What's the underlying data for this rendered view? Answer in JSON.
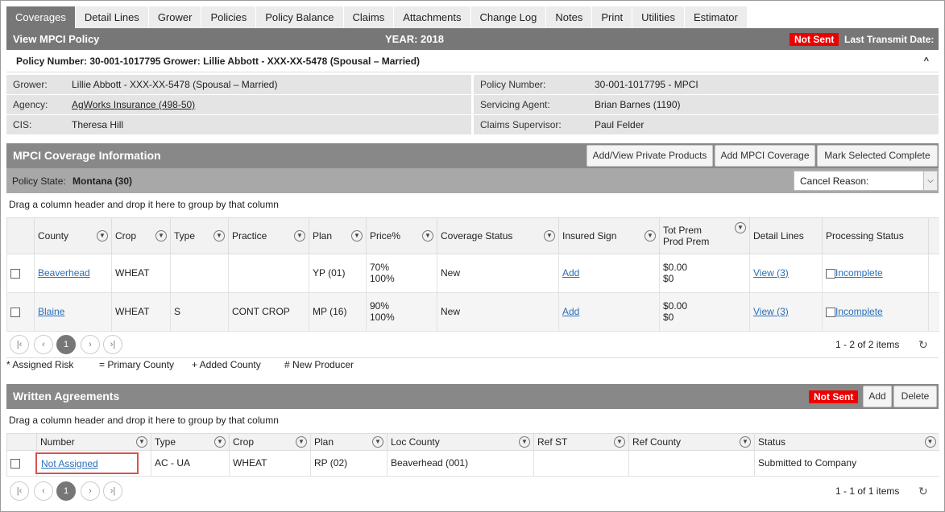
{
  "tabs": [
    "Coverages",
    "Detail Lines",
    "Grower",
    "Policies",
    "Policy Balance",
    "Claims",
    "Attachments",
    "Change Log",
    "Notes",
    "Print",
    "Utilities",
    "Estimator"
  ],
  "header": {
    "title": "View MPCI Policy",
    "year": "YEAR: 2018",
    "status_badge": "Not Sent",
    "transmit_label": "Last Transmit Date:"
  },
  "policy_line": "Policy Number: 30-001-1017795 Grower: Lillie Abbott - XXX-XX-5478 (Spousal – Married)",
  "collapse_glyph": "^",
  "info": {
    "grower_label": "Grower:",
    "grower_value": "Lillie Abbott - XXX-XX-5478 (Spousal – Married)",
    "agency_label": "Agency:",
    "agency_value": "AgWorks Insurance (498-50)",
    "cis_label": "CIS:",
    "cis_value": "Theresa Hill",
    "policy_label": "Policy Number:",
    "policy_value": "30-001-1017795 - MPCI",
    "agent_label": "Servicing Agent:",
    "agent_value": "Brian Barnes (1190)",
    "supervisor_label": "Claims Supervisor:",
    "supervisor_value": "Paul Felder"
  },
  "coverage": {
    "title": "MPCI Coverage Information",
    "btn_private": "Add/View Private Products",
    "btn_add": "Add MPCI Coverage",
    "btn_complete": "Mark Selected Complete",
    "state_label": "Policy State:",
    "state_value": "Montana (30)",
    "cancel_reason": "Cancel Reason:",
    "drag_hint": "Drag a column header and drop it here to group by that column",
    "columns": [
      "County",
      "Crop",
      "Type",
      "Practice",
      "Plan",
      "Price%",
      "Coverage Status",
      "Insured Sign",
      "Tot Prem",
      "Prod Prem",
      "Detail Lines",
      "Processing Status"
    ],
    "rows": [
      {
        "county": "Beaverhead",
        "crop": "WHEAT",
        "type": "",
        "practice": "",
        "plan": "YP (01)",
        "price1": "70%",
        "price2": "100%",
        "status": "New",
        "sign": "Add",
        "tot": "$0.00",
        "prod": "$0",
        "detail": "View (3)",
        "proc": "Incomplete"
      },
      {
        "county": "Blaine",
        "crop": "WHEAT",
        "type": "S",
        "practice": "CONT CROP",
        "plan": "MP (16)",
        "price1": "90%",
        "price2": "100%",
        "status": "New",
        "sign": "Add",
        "tot": "$0.00",
        "prod": "$0",
        "detail": "View (3)",
        "proc": "Incomplete"
      }
    ],
    "pager": {
      "page": "1",
      "summary": "1 - 2 of 2 items"
    }
  },
  "legend": [
    "* Assigned Risk",
    "= Primary County",
    "+ Added County",
    "# New Producer"
  ],
  "agreements": {
    "title": "Written Agreements",
    "badge": "Not Sent",
    "btn_add": "Add",
    "btn_delete": "Delete",
    "drag_hint": "Drag a column header and drop it here to group by that column",
    "columns": [
      "Number",
      "Type",
      "Crop",
      "Plan",
      "Loc County",
      "Ref ST",
      "Ref County",
      "Status"
    ],
    "rows": [
      {
        "number": "Not Assigned",
        "type": "AC - UA",
        "crop": "WHEAT",
        "plan": "RP (02)",
        "loc": "Beaverhead (001)",
        "refst": "",
        "refcounty": "",
        "status": "Submitted to Company"
      }
    ],
    "pager": {
      "page": "1",
      "summary": "1 - 1 of 1 items"
    }
  },
  "icons": {
    "filter": "filter-icon",
    "refresh": "refresh-icon",
    "first": "first-page-icon",
    "prev": "prev-page-icon",
    "next": "next-page-icon",
    "last": "last-page-icon"
  },
  "colors": {
    "header_gray": "#777777",
    "section_gray": "#888888",
    "badge_red": "#ee0000",
    "link_blue": "#2a6fb8"
  }
}
